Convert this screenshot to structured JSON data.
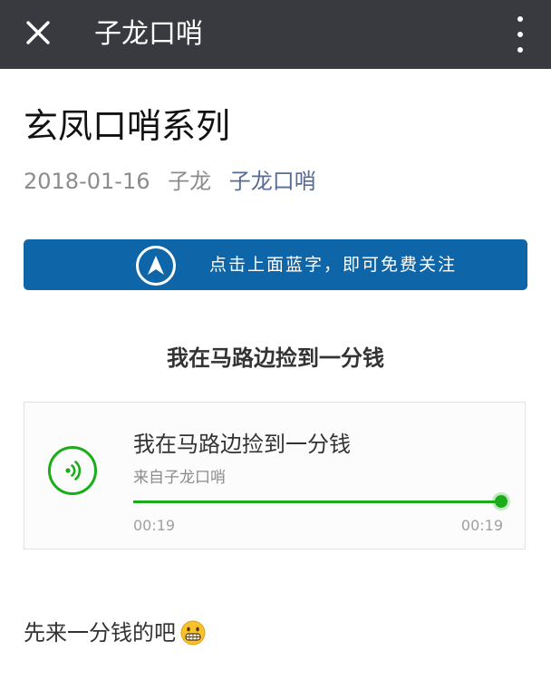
{
  "topbar": {
    "close_icon": "close-icon",
    "title": "子龙口哨",
    "more_icon": "more-vertical-icon"
  },
  "article": {
    "title": "玄凤口哨系列",
    "date": "2018-01-16",
    "author": "子龙",
    "account": "子龙口哨"
  },
  "banner": {
    "icon": "navigation-arrow-icon",
    "text": "点击上面蓝字，即可免费关注",
    "color": "#0e65a8"
  },
  "section": {
    "heading": "我在马路边捡到一分钱"
  },
  "audio": {
    "icon": "audio-wave-icon",
    "title": "我在马路边捡到一分钱",
    "source": "来自子龙口哨",
    "current_time": "00:19",
    "total_time": "00:19",
    "progress_fraction": 1.0,
    "accent": "#1aad19"
  },
  "body": {
    "text": "先来一分钱的吧",
    "emoji": "grimacing-face-emoji"
  }
}
